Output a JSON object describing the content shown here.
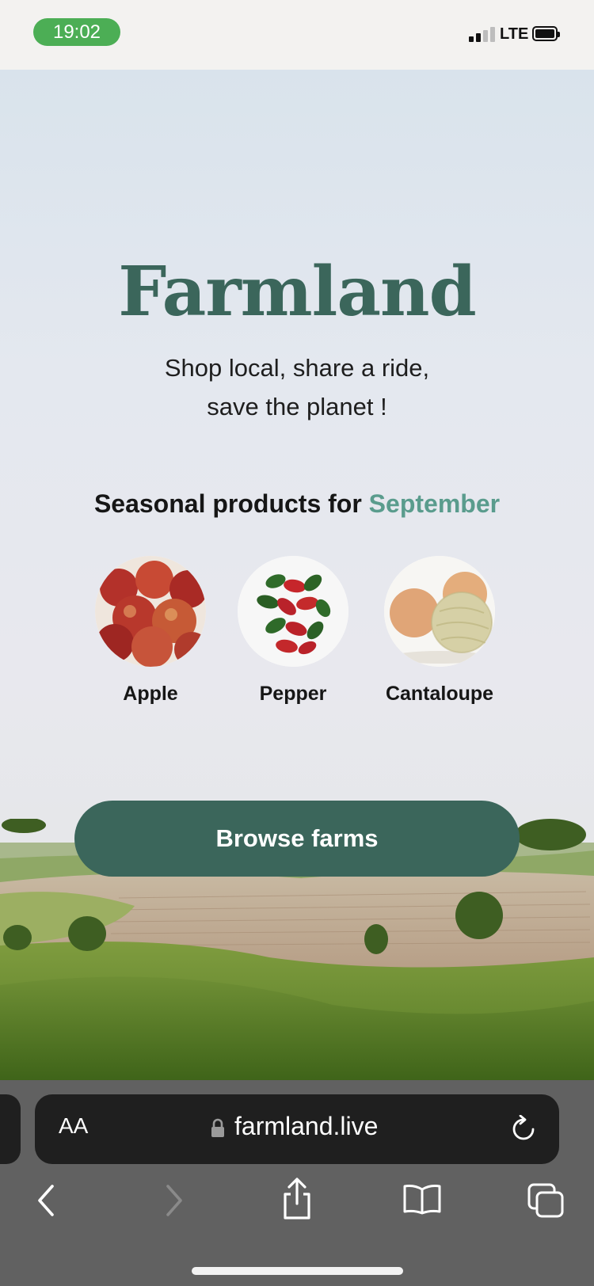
{
  "status_bar": {
    "time": "19:02",
    "network": "LTE"
  },
  "hero": {
    "brand": "Farmland",
    "tagline": [
      "Shop local, share a ride,",
      "save the planet !"
    ],
    "seasonal_prefix": "Seasonal products for",
    "month": "September",
    "products": [
      {
        "name": "Apple",
        "icon": "apple-image"
      },
      {
        "name": "Pepper",
        "icon": "pepper-image"
      },
      {
        "name": "Cantaloupe",
        "icon": "cantaloupe-image"
      }
    ],
    "cta_label": "Browse farms"
  },
  "browser": {
    "text_size_label": "AA",
    "url": "farmland.live",
    "icons": [
      "lock-icon",
      "reload-icon",
      "back-icon",
      "forward-icon",
      "share-icon",
      "bookmarks-icon",
      "tabs-icon"
    ]
  },
  "colors": {
    "brand": "#3b665b",
    "accent": "#5a9c8d",
    "time_pill": "#4cae55"
  }
}
